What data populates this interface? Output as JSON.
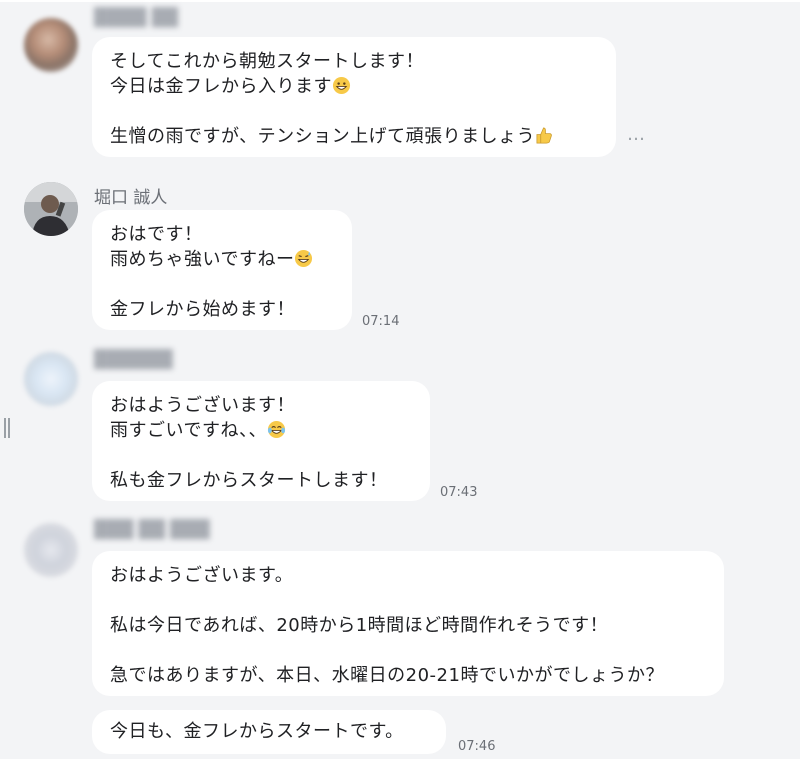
{
  "messages": [
    {
      "sender": "",
      "lines": [
        "そしてこれから朝勉スタートします！",
        "今日は金フレから入ります",
        "",
        "生憎の雨ですが、テンション上げて頑張りましょう"
      ],
      "time": "",
      "emojis": [
        "grinning-face-emoji",
        "thumbs-up-emoji"
      ]
    },
    {
      "sender": "堀口 誠人",
      "lines": [
        "おはです！",
        "雨めちゃ強いですねー",
        "",
        "金フレから始めます！"
      ],
      "time": "07:14",
      "emojis": [
        "grinning-sweat-emoji"
      ]
    },
    {
      "sender": "",
      "lines": [
        "おはようございます！",
        "雨すごいですね、、",
        "",
        "私も金フレからスタートします！"
      ],
      "time": "07:43",
      "emojis": [
        "tears-of-joy-emoji"
      ]
    },
    {
      "sender": "",
      "lines": [
        "おはようございます。",
        "",
        "私は今日であれば、20時から1時間ほど時間作れそうです！",
        "",
        "急ではありますが、本日、水曜日の20-21時でいかがでしょうか？"
      ],
      "time": ""
    },
    {
      "sender": "",
      "lines": [
        "今日も、金フレからスタートです。"
      ],
      "time": "07:46"
    }
  ],
  "more_icon": "…",
  "colors": {
    "background": "#f3f4f6",
    "bubble": "#ffffff",
    "meta_text": "#6b6f76"
  }
}
